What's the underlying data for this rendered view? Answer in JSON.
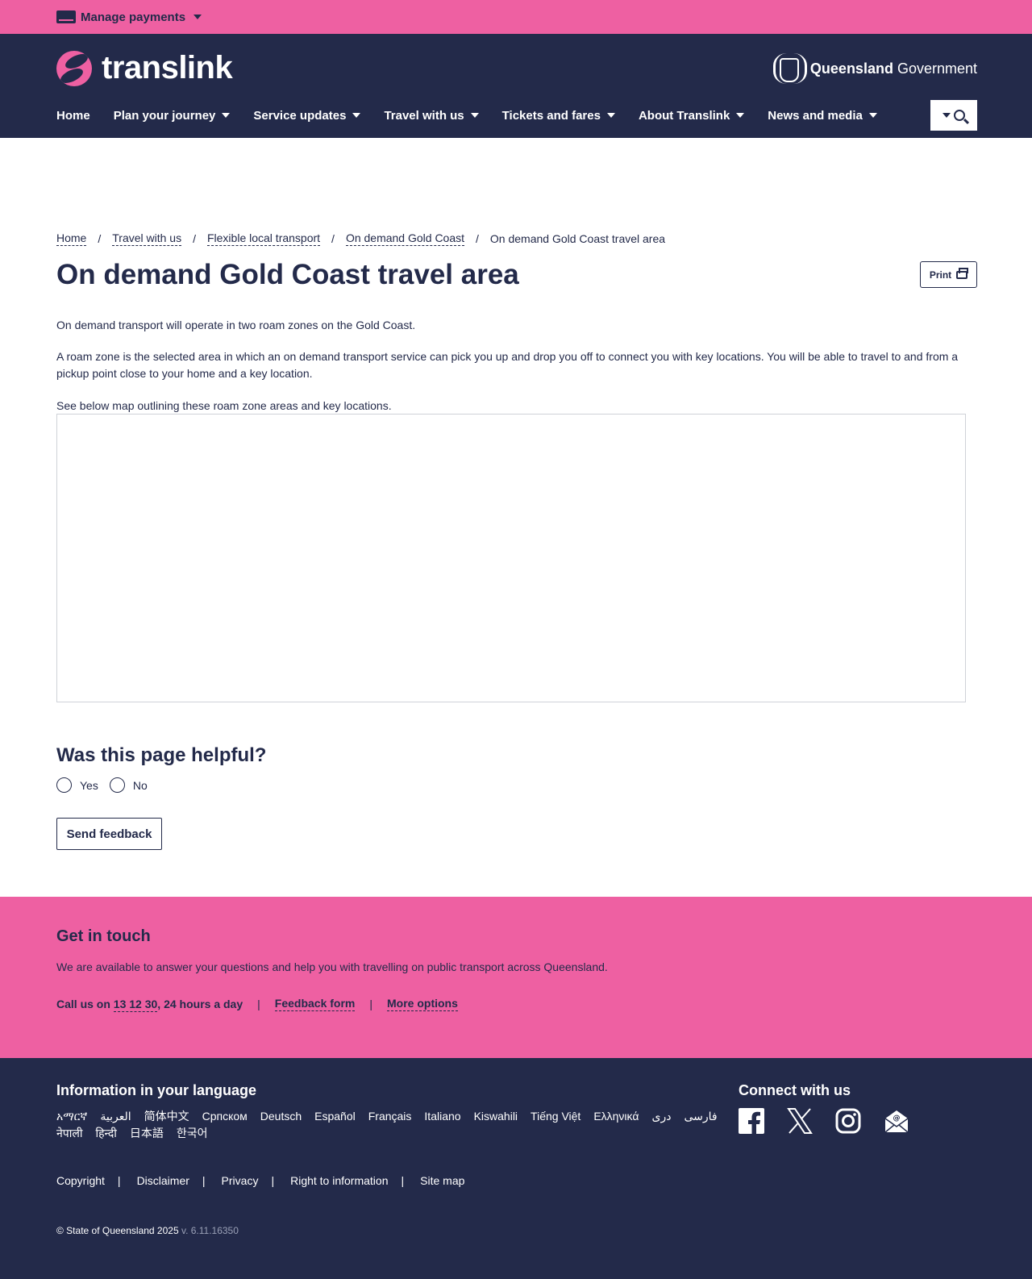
{
  "topbar": {
    "manage_label": "Manage payments",
    "card_icon": "card-icon"
  },
  "header": {
    "logo_text": "translink",
    "gov_bold": "Queensland",
    "gov_light": " Government",
    "nav": [
      {
        "label": "Home",
        "has_caret": false
      },
      {
        "label": "Plan your journey",
        "has_caret": true
      },
      {
        "label": "Service updates",
        "has_caret": true
      },
      {
        "label": "Travel with us",
        "has_caret": true
      },
      {
        "label": "Tickets and fares",
        "has_caret": true
      },
      {
        "label": "About Translink",
        "has_caret": true
      },
      {
        "label": "News and media",
        "has_caret": true
      }
    ]
  },
  "breadcrumb": [
    {
      "label": "Home",
      "link": true
    },
    {
      "label": "Travel with us",
      "link": true
    },
    {
      "label": "Flexible local transport",
      "link": true
    },
    {
      "label": "On demand Gold Coast",
      "link": true
    },
    {
      "label": "On demand Gold Coast travel area",
      "link": false
    }
  ],
  "main": {
    "title": "On demand Gold Coast travel area",
    "print_label": "Print",
    "paragraphs": [
      "On demand transport will operate in two roam zones on the Gold Coast.",
      "A roam zone is the selected area in which an on demand transport service can pick you up and drop you off to connect you with key locations. You will be able to travel to and from a pickup point close to your home and a key location.",
      "See below map outlining these roam zone areas and key locations."
    ]
  },
  "feedback": {
    "title": "Was this page helpful?",
    "yes": "Yes",
    "no": "No",
    "button": "Send feedback"
  },
  "touch": {
    "title": "Get in touch",
    "text": "We are available to answer your questions and help you with travelling on public transport across Queensland.",
    "call_prefix": "Call us on ",
    "phone": "13 12 30",
    "call_suffix": ", 24 hours a day",
    "feedback_form": "Feedback form",
    "more_options": "More options"
  },
  "footer": {
    "lang_title": "Information in your language",
    "languages": [
      "አማርኛ",
      "العربية",
      "简体中文",
      "Српском",
      "Deutsch",
      "Español",
      "Français",
      "Italiano",
      "Kiswahili",
      "Tiếng Việt",
      "Ελληνικά",
      "دری",
      "فارسی",
      "नेपाली",
      "हिन्दी",
      "日本語",
      "한국어"
    ],
    "connect_title": "Connect with us",
    "socials": [
      "facebook-icon",
      "x-icon",
      "instagram-icon",
      "email-icon"
    ],
    "links": [
      "Copyright",
      "Disclaimer",
      "Privacy",
      "Right to information",
      "Site map"
    ],
    "copyright": "© State of Queensland 2025",
    "version": " v. 6.11.16350"
  },
  "colors": {
    "pink": "#ee60a2",
    "navy": "#232a4a"
  }
}
